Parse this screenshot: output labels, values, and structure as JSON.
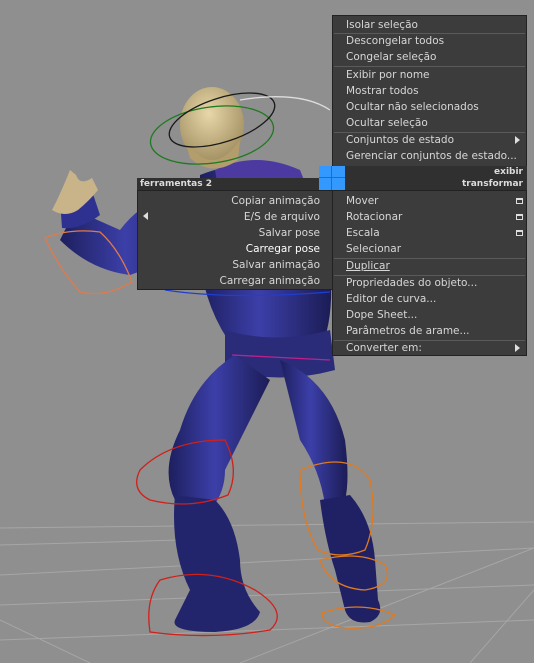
{
  "quad_right": {
    "items": [
      "Isolar seleção",
      "Descongelar todos",
      "Congelar seleção",
      "Exibir por nome",
      "Mostrar todos",
      "Ocultar não selecionados",
      "Ocultar seleção",
      "Conjuntos de estado",
      "Gerenciar conjuntos de estado..."
    ],
    "header_top": "exibir",
    "header_bottom": "transformar",
    "transform_items": [
      "Mover",
      "Rotacionar",
      "Escala",
      "Selecionar",
      "Duplicar",
      "Propriedades do objeto...",
      "Editor de curva...",
      "Dope Sheet...",
      "Parâmetros de arame...",
      "Converter em:"
    ]
  },
  "quad_left": {
    "header": "ferramentas 2",
    "items": [
      "Copiar animação",
      "E/S de arquivo",
      "Salvar pose",
      "Carregar pose",
      "Salvar animação",
      "Carregar animação"
    ]
  },
  "colors": {
    "viewport_bg": "#8f8f8f",
    "menu_bg": "#3c3c3c",
    "quad_center": "#3399ff",
    "character": "#2b2d7e",
    "rig_red": "#d0201a",
    "rig_orange": "#e07a20"
  }
}
